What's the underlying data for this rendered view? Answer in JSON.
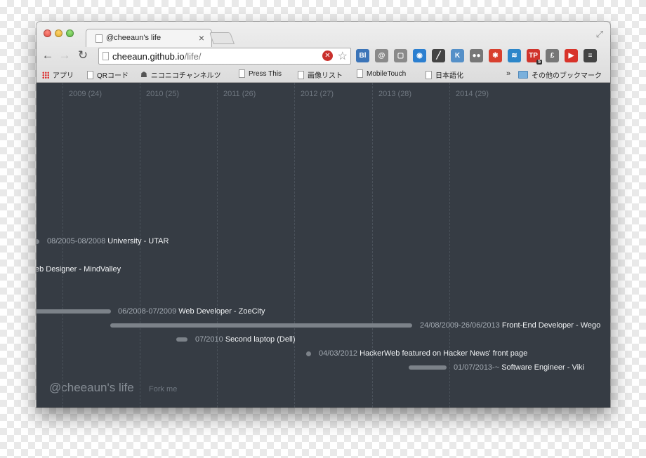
{
  "tab": {
    "title": "@cheeaun's life",
    "close": "×"
  },
  "nav": {
    "back": "←",
    "forward": "→",
    "reload": "↻"
  },
  "address": {
    "host": "cheeaun.github.io",
    "path": "/life/"
  },
  "extensions": [
    {
      "name": "bitly-icon",
      "label": "Bl",
      "color": "#3b74b8",
      "badge": ""
    },
    {
      "name": "document-icon",
      "label": "@",
      "color": "#8a8a8a",
      "badge": ""
    },
    {
      "name": "window-icon",
      "label": "▢",
      "color": "#8a8a8a",
      "badge": ""
    },
    {
      "name": "eye-icon",
      "label": "◉",
      "color": "#2b7fd0",
      "badge": ""
    },
    {
      "name": "eyedropper-icon",
      "label": "╱",
      "color": "#444444",
      "badge": ""
    },
    {
      "name": "kuler-icon",
      "label": "K",
      "color": "#5590c8",
      "badge": ""
    },
    {
      "name": "dots-icon",
      "label": "●●",
      "color": "#777777",
      "badge": ""
    },
    {
      "name": "asterisk-icon",
      "label": "✱",
      "color": "#d8402f",
      "badge": ""
    },
    {
      "name": "wave-icon",
      "label": "≋",
      "color": "#2c86c9",
      "badge": ""
    },
    {
      "name": "tp-icon",
      "label": "TP",
      "color": "#d0342c",
      "badge": "5"
    },
    {
      "name": "pound-icon",
      "label": "£",
      "color": "#777777",
      "badge": ""
    },
    {
      "name": "play-icon",
      "label": "▶",
      "color": "#d8332a",
      "badge": ""
    },
    {
      "name": "menu-icon",
      "label": "≡",
      "color": "#444444",
      "badge": ""
    }
  ],
  "bookmarks": [
    {
      "label": "アプリ",
      "icon": "grid"
    },
    {
      "label": "QRコード",
      "icon": "page"
    },
    {
      "label": "ニコニコチャンネルツ",
      "icon": "robot"
    },
    {
      "label": "Press This",
      "icon": "page"
    },
    {
      "label": "画像リスト",
      "icon": "page"
    },
    {
      "label": "MobileTouch",
      "icon": "page"
    },
    {
      "label": "日本語化",
      "icon": "page"
    }
  ],
  "bookmarks_more": "»",
  "other_bookmarks": "その他のブックマーク",
  "timeline": {
    "years": [
      "2009 (24)",
      "2010 (25)",
      "2011 (26)",
      "2012 (27)",
      "2013 (28)",
      "2014 (29)"
    ],
    "events": [
      {
        "date": "08/2005-08/2008",
        "name": "University - UTAR"
      },
      {
        "date": "",
        "name": "eb Designer - MindValley"
      },
      {
        "date": "06/2008-07/2009",
        "name": "Web Developer - ZoeCity"
      },
      {
        "date": "24/08/2009-26/06/2013",
        "name": "Front-End Developer - Wego"
      },
      {
        "date": "07/2010",
        "name": "Second laptop (Dell)"
      },
      {
        "date": "04/03/2012",
        "name": "HackerWeb featured on Hacker News' front page"
      },
      {
        "date": "01/07/2013-~",
        "name": "Software Engineer - Viki"
      }
    ]
  },
  "footer": {
    "title": "@cheeaun's life",
    "fork": "Fork me"
  }
}
